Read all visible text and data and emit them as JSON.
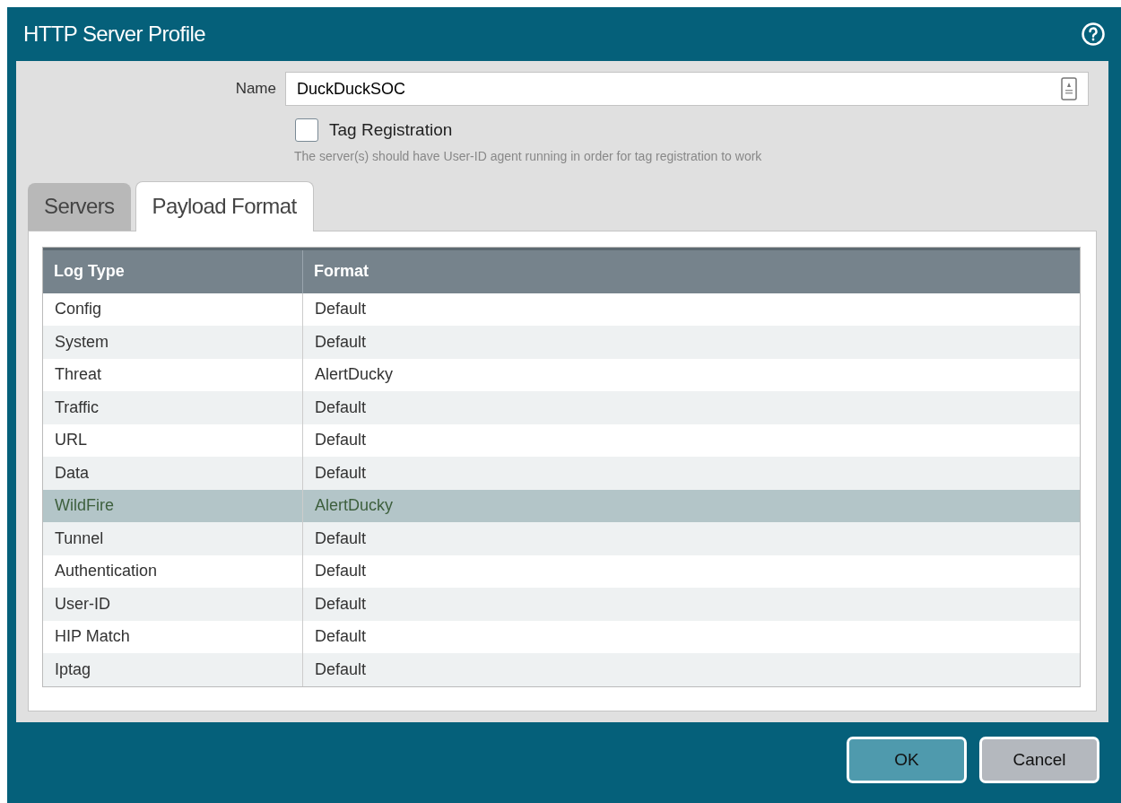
{
  "window": {
    "title": "HTTP Server Profile"
  },
  "name_field": {
    "label": "Name",
    "value": "DuckDuckSOC"
  },
  "tag_registration": {
    "label": "Tag Registration",
    "checked": false,
    "hint": "The server(s) should have User-ID agent running in order for tag registration to work"
  },
  "tabs": [
    {
      "label": "Servers",
      "selected": false
    },
    {
      "label": "Payload Format",
      "selected": true
    }
  ],
  "table": {
    "columns": [
      "Log Type",
      "Format"
    ],
    "rows": [
      {
        "cells": [
          "Config",
          "Default"
        ],
        "selected": false
      },
      {
        "cells": [
          "System",
          "Default"
        ],
        "selected": false
      },
      {
        "cells": [
          "Threat",
          "AlertDucky"
        ],
        "selected": false
      },
      {
        "cells": [
          "Traffic",
          "Default"
        ],
        "selected": false
      },
      {
        "cells": [
          "URL",
          "Default"
        ],
        "selected": false
      },
      {
        "cells": [
          "Data",
          "Default"
        ],
        "selected": false
      },
      {
        "cells": [
          "WildFire",
          "AlertDucky"
        ],
        "selected": true
      },
      {
        "cells": [
          "Tunnel",
          "Default"
        ],
        "selected": false
      },
      {
        "cells": [
          "Authentication",
          "Default"
        ],
        "selected": false
      },
      {
        "cells": [
          "User-ID",
          "Default"
        ],
        "selected": false
      },
      {
        "cells": [
          "HIP Match",
          "Default"
        ],
        "selected": false
      },
      {
        "cells": [
          "Iptag",
          "Default"
        ],
        "selected": false
      }
    ]
  },
  "buttons": [
    {
      "label": "OK",
      "kind": "primary"
    },
    {
      "label": "Cancel",
      "kind": "secondary"
    }
  ]
}
